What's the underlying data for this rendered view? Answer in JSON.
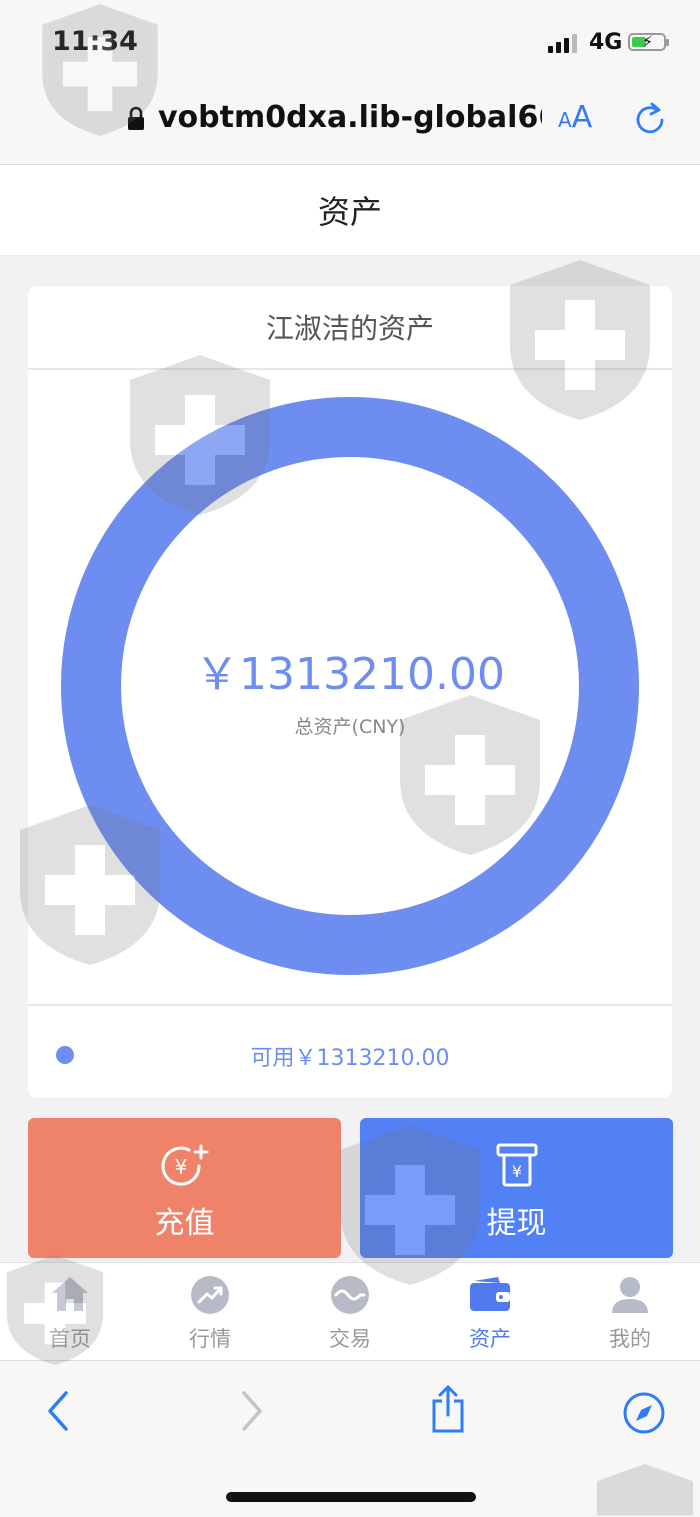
{
  "status_bar": {
    "time": "11:34",
    "network": "4G"
  },
  "browser": {
    "url": "vobtm0dxa.lib-global66.c",
    "text_size_small": "A",
    "text_size_large": "A"
  },
  "page": {
    "title": "资产"
  },
  "asset_card": {
    "title": "江淑洁的资产",
    "total": "￥1313210.00",
    "total_label": "总资产(CNY)",
    "legend_text": "可用￥1313210.00",
    "ring_color": "#6d8ef0",
    "available_fraction": 1.0
  },
  "actions": {
    "recharge_label": "充值",
    "withdraw_label": "提现",
    "recharge_color": "#ee836a",
    "withdraw_color": "#5280f5"
  },
  "tabbar": {
    "items": [
      {
        "label": "首页",
        "icon": "home-icon"
      },
      {
        "label": "行情",
        "icon": "trend-icon"
      },
      {
        "label": "交易",
        "icon": "exchange-icon"
      },
      {
        "label": "资产",
        "icon": "wallet-icon",
        "active": true
      },
      {
        "label": "我的",
        "icon": "user-icon"
      }
    ],
    "active_color": "#4f7bef"
  }
}
